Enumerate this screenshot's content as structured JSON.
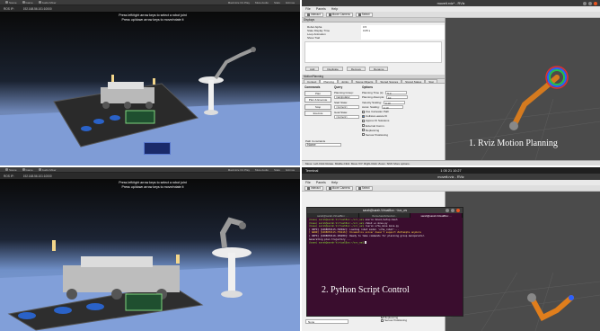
{
  "left_views": [
    {
      "tabs": [
        "Scene",
        "Game",
        "Audio Mixer"
      ],
      "tabs_right": [
        "Maximize On Play",
        "Mute Audio",
        "Stats",
        "Gizmos"
      ],
      "display_label": "ROS IP:",
      "display_value": "192.168.56.101:10000",
      "hint_line1": "Press left/right arrow keys to select a robot joint",
      "hint_line2": "Press up/down arrow keys to move/rotate it"
    },
    {
      "tabs": [
        "Scene",
        "Game",
        "Audio Mixer"
      ],
      "tabs_right": [
        "Maximize On Play",
        "Mute Audio",
        "Stats",
        "Gizmos"
      ],
      "display_label": "ROS IP:",
      "display_value": "192.168.56.101:10000",
      "hint_line1": "Press left/right arrow keys to select a robot joint",
      "hint_line2": "Press up/down arrow keys to move/rotate it"
    }
  ],
  "rviz_top": {
    "window_title": "moveit.rviz* - RViz",
    "menu": [
      "File",
      "Panels",
      "Help"
    ],
    "toolbar": [
      "Interact",
      "Move Camera",
      "Select"
    ],
    "displays_header": "Displays",
    "display_rows": [
      {
        "k": "Robot Alpha",
        "v": "0.5"
      },
      {
        "k": "State Display Time",
        "v": "0.05 s"
      },
      {
        "k": "Loop Animation",
        "v": ""
      },
      {
        "k": "Show Trail",
        "v": ""
      }
    ],
    "display_buttons": [
      "Add",
      "Duplicate",
      "Remove",
      "Rename"
    ],
    "motion_header": "MotionPlanning",
    "tabs": [
      "Context",
      "Planning",
      "Joints",
      "Scene Objects",
      "Stored Scenes",
      "Stored States",
      "Stat"
    ],
    "col_commands": {
      "title": "Commands",
      "buttons": [
        "Plan",
        "Plan & Execute",
        "Stop",
        "Execute"
      ]
    },
    "col_query": {
      "title": "Query",
      "labels": [
        "Planning Group:",
        "Start State:",
        "Goal State:"
      ],
      "selects": [
        "manipulator",
        "<current>",
        "<current>"
      ]
    },
    "col_options": {
      "title": "Options",
      "fields": [
        {
          "k": "Planning Time (s):",
          "v": "5.0"
        },
        {
          "k": "Planning Attempts:",
          "v": "10"
        },
        {
          "k": "Velocity Scaling:",
          "v": "0.10"
        },
        {
          "k": "Accel. Scaling:",
          "v": "0.10"
        }
      ],
      "checks": [
        {
          "label": "Use Cartesian Path",
          "on": false
        },
        {
          "label": "Collision-aware IK",
          "on": true
        },
        {
          "label": "Approx IK Solutions",
          "on": false
        },
        {
          "label": "External Comm.",
          "on": false
        },
        {
          "label": "Replanning",
          "on": false
        },
        {
          "label": "Sensor Positioning",
          "on": false
        }
      ]
    },
    "path_constraints_label": "Path Constraints",
    "path_constraints_value": "None",
    "status": "Move: Left-Click Rotate. Middle-Click: Move X/Y. Right-Click: Zoom. Shift: More options.",
    "caption": "1. Rviz Motion Planning"
  },
  "rviz_bottom": {
    "os_topbar_left": "Terminal",
    "os_topbar_time": "1 05 21 10:27",
    "window_title": "moveit.rviz - RViz",
    "menu": [
      "File",
      "Panels",
      "Help"
    ],
    "toolbar": [
      "Interact",
      "Move Camera",
      "Select"
    ],
    "terminal_title": "sarah@sarah-VirtualBox: ~/src_ws",
    "terminal_tabs": [
      "sarah@sarah-VirtualBox: ...",
      "/home/sarah/dev/ws/...",
      "sarah@sarah-VirtualBox: ..."
    ],
    "terminal_lines": [
      {
        "kind": "pr",
        "prompt": "(base) sarah@sarah-VirtualBox:~/src_ws$",
        "text": " source devel/setup.bash"
      },
      {
        "kind": "pr",
        "prompt": "(base) sarah@sarah-VirtualBox:~/src_ws$",
        "text": " chmod +x move.py"
      },
      {
        "kind": "pr",
        "prompt": "(base) sarah@sarah-VirtualBox:~/src_ws$",
        "text": " rosrun ur5e_move move.py"
      },
      {
        "kind": "info",
        "prompt": "",
        "text": "[ INFO] [1608053115.720942]: Loading robot model 'ur5e_robot'..."
      },
      {
        "kind": "warn",
        "prompt": "",
        "text": "[ WARN] [1608053115.739416]: Kinematics solver doesn't support #attempts anymore"
      },
      {
        "kind": "info",
        "prompt": "",
        "text": "[ INFO] [1608053116.159209]: Ready to take commands for planning group manipulator."
      },
      {
        "kind": "info",
        "prompt": "",
        "text": "Generating plan trajectory ..."
      },
      {
        "kind": "pr",
        "prompt": "(base) sarah@sarah-VirtualBox:~/src_ws$",
        "text": " "
      }
    ],
    "path_constraints_value": "None",
    "checks": [
      "Replanning",
      "Sensor Positioning"
    ],
    "caption": "2. Python Script Control"
  }
}
